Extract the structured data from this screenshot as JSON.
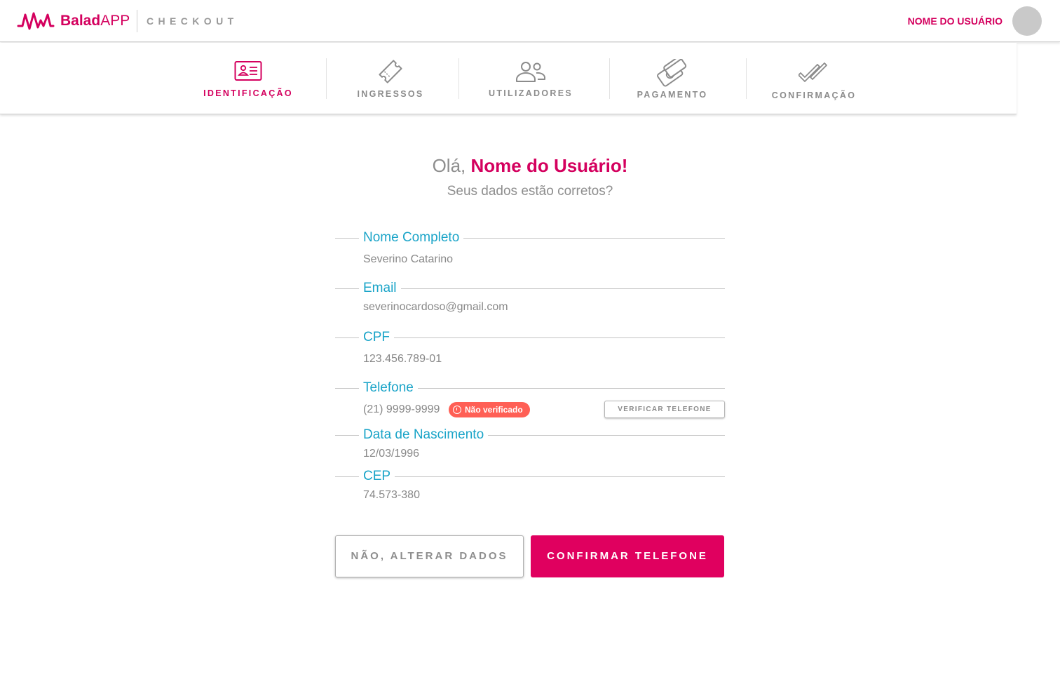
{
  "header": {
    "brand_bold": "Balad",
    "brand_light": "APP",
    "section": "CHECKOUT",
    "user_name": "NOME DO USUÁRIO",
    "logo_icon": "pulse-wave-icon",
    "avatar_icon": "avatar-placeholder"
  },
  "steps": [
    {
      "label": "IDENTIFICAÇÃO",
      "icon": "id-card-icon",
      "active": true
    },
    {
      "label": "INGRESSOS",
      "icon": "ticket-icon",
      "active": false
    },
    {
      "label": "UTILIZADORES",
      "icon": "users-icon",
      "active": false
    },
    {
      "label": "PAGAMENTO",
      "icon": "payment-icon",
      "active": false
    },
    {
      "label": "CONFIRMAÇÃO",
      "icon": "double-check-icon",
      "active": false
    }
  ],
  "greeting": {
    "hello": "Olá, ",
    "name": "Nome do Usuário!",
    "subtitle": "Seus dados estão corretos?"
  },
  "fields": {
    "full_name": {
      "label": "Nome Completo",
      "value": "Severino Catarino"
    },
    "email": {
      "label": "Email",
      "value": "severinocardoso@gmail.com"
    },
    "cpf": {
      "label": "CPF",
      "value": "123.456.789-01"
    },
    "phone": {
      "label": "Telefone",
      "value": "(21) 9999-9999",
      "badge": "Não verificado",
      "verify_button": "VERIFICAR TELEFONE"
    },
    "birth_date": {
      "label": "Data de Nascimento",
      "value": "12/03/1996"
    },
    "cep": {
      "label": "CEP",
      "value": "74.573-380"
    }
  },
  "actions": {
    "alter": "NÃO, ALTERAR DADOS",
    "confirm": "CONFIRMAR TELEFONE"
  },
  "colors": {
    "accent": "#d4005e",
    "label": "#1aa4c8",
    "badge": "#ff5f55",
    "muted": "#8e8e8e"
  }
}
